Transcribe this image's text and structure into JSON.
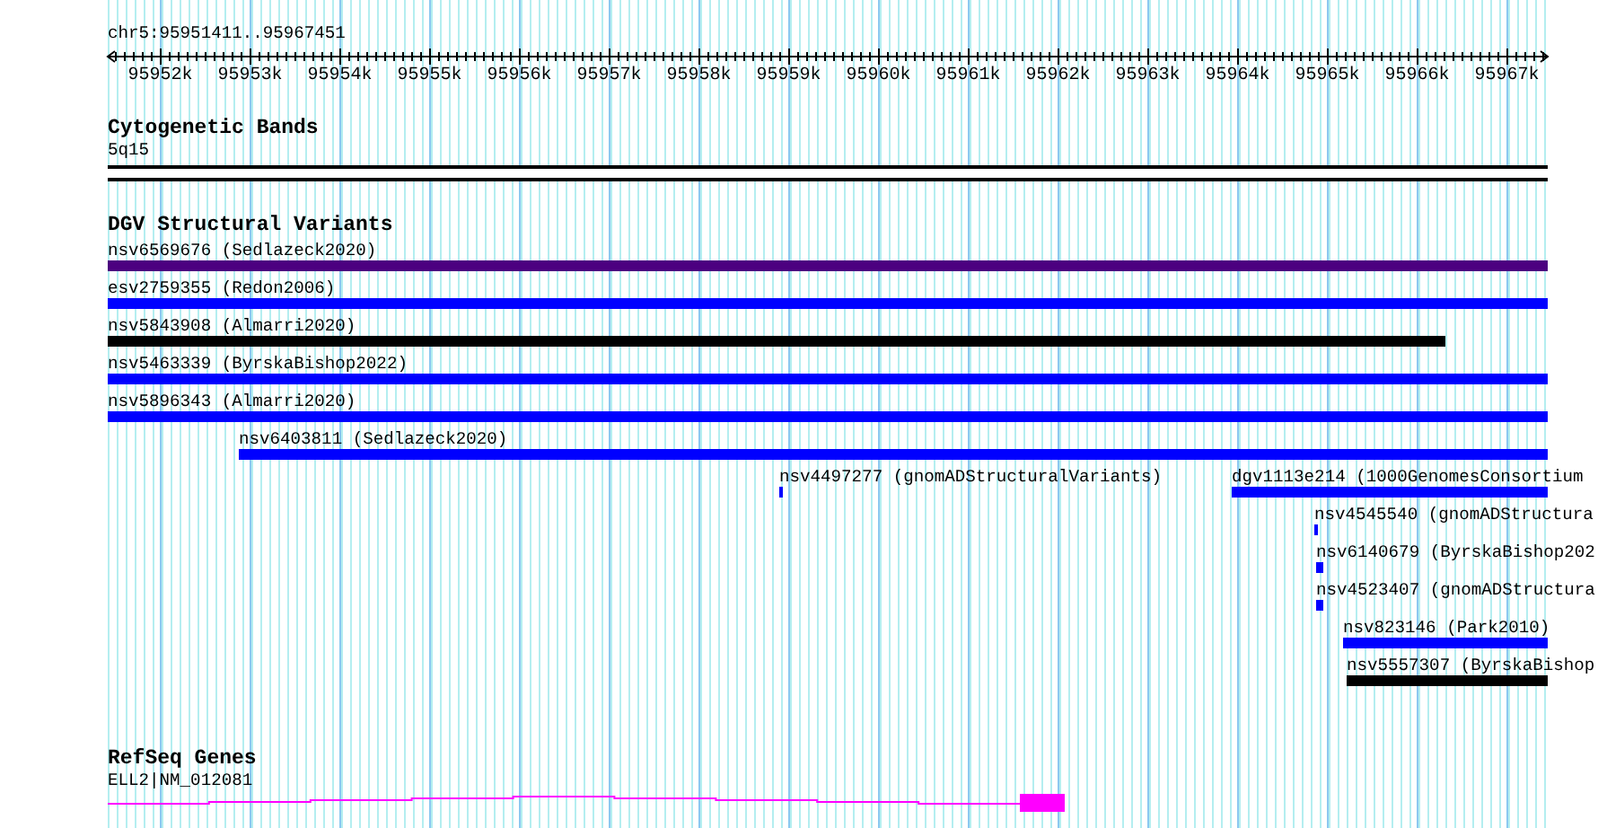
{
  "ruler": {
    "title": "chr5:95951411..95967451",
    "ticks": [
      "95952k",
      "95953k",
      "95954k",
      "95955k",
      "95956k",
      "95957k",
      "95958k",
      "95959k",
      "95960k",
      "95961k",
      "95962k",
      "95963k",
      "95964k",
      "95965k",
      "95966k",
      "95967k"
    ]
  },
  "cytogenetic_bands": {
    "title": "Cytogenetic Bands",
    "band": "5q15"
  },
  "dgv_structural_variants": {
    "title": "DGV Structural Variants",
    "lanes": [
      {
        "features": [
          {
            "label": "nsv6569676 (Sedlazeck2020)",
            "color": "#4c0080"
          }
        ]
      },
      {
        "features": [
          {
            "label": "esv2759355 (Redon2006)",
            "color": "#0000ff"
          }
        ]
      },
      {
        "features": [
          {
            "label": "nsv5843908 (Almarri2020)",
            "color": "#000000"
          }
        ]
      },
      {
        "features": [
          {
            "label": "nsv5463339 (ByrskaBishop2022)",
            "color": "#0000ff"
          }
        ]
      },
      {
        "features": [
          {
            "label": "nsv5896343 (Almarri2020)",
            "color": "#0000ff"
          }
        ]
      },
      {
        "features": [
          {
            "label": "nsv6403811 (Sedlazeck2020)",
            "color": "#0000ff"
          }
        ]
      },
      {
        "features": [
          {
            "label": "nsv4497277 (gnomADStructuralVariants)",
            "color": "#0000ff"
          },
          {
            "label": "dgv1113e214 (1000GenomesConsortium",
            "color": "#0000ff"
          }
        ]
      },
      {
        "features": [
          {
            "label": "nsv4545540 (gnomADStructura",
            "color": "#0000ff"
          }
        ]
      },
      {
        "features": [
          {
            "label": "nsv6140679 (ByrskaBishop202",
            "color": "#0000ff"
          }
        ]
      },
      {
        "features": [
          {
            "label": "nsv4523407 (gnomADStructura",
            "color": "#0000ff"
          }
        ]
      },
      {
        "features": [
          {
            "label": "nsv823146 (Park2010)",
            "color": "#0000ff"
          }
        ]
      },
      {
        "features": [
          {
            "label": "nsv5557307 (ByrskaBishop",
            "color": "#000000"
          }
        ]
      }
    ]
  },
  "refseq_genes": {
    "title": "RefSeq Genes",
    "gene": {
      "label": "ELL2|NM_012081"
    }
  }
}
